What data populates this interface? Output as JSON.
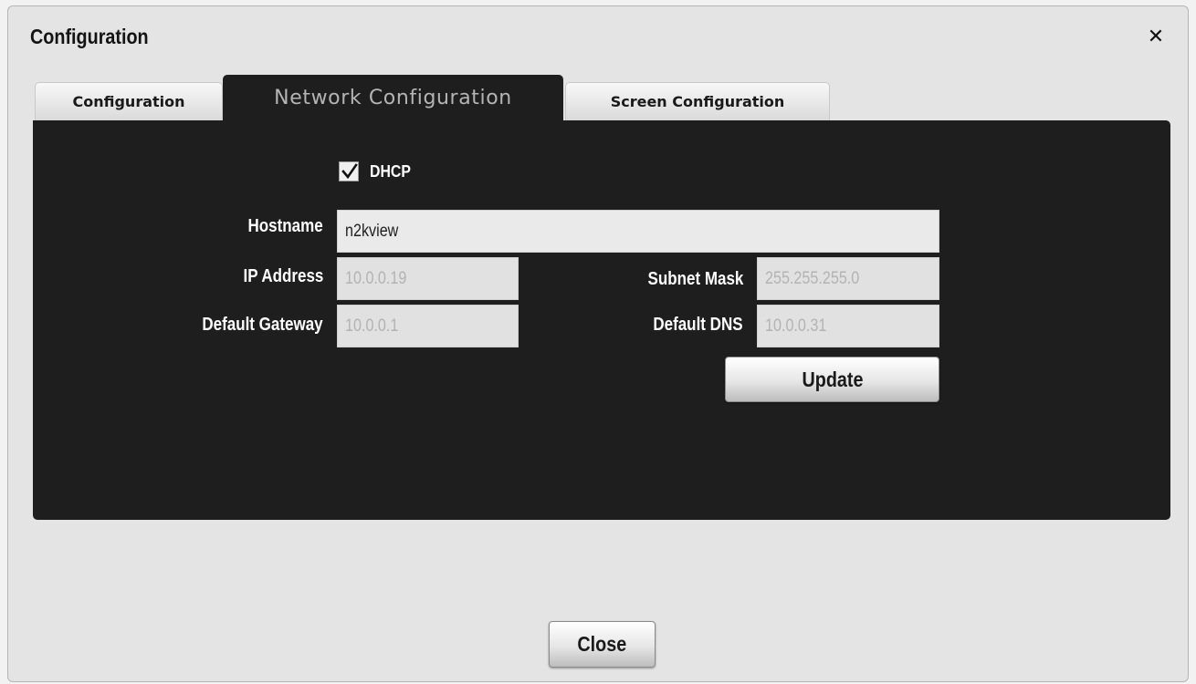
{
  "dialog": {
    "title": "Configuration",
    "close_icon": "close-icon"
  },
  "tabs": [
    {
      "label": "Configuration",
      "active": false
    },
    {
      "label": "Network Configuration",
      "active": true
    },
    {
      "label": "Screen Configuration",
      "active": false
    }
  ],
  "network": {
    "dhcp": {
      "label": "DHCP",
      "checked": true
    },
    "hostname": {
      "label": "Hostname",
      "value": "n2kview"
    },
    "ip_address": {
      "label": "IP Address",
      "value": "10.0.0.19"
    },
    "subnet_mask": {
      "label": "Subnet Mask",
      "value": "255.255.255.0"
    },
    "default_gateway": {
      "label": "Default Gateway",
      "value": "10.0.0.1"
    },
    "default_dns": {
      "label": "Default DNS",
      "value": "10.0.0.31"
    },
    "update_label": "Update"
  },
  "footer": {
    "close_label": "Close"
  },
  "colors": {
    "panel_bg": "#1e1e1e",
    "dialog_bg": "#e4e4e4",
    "disabled_text": "#b3b3b3"
  }
}
